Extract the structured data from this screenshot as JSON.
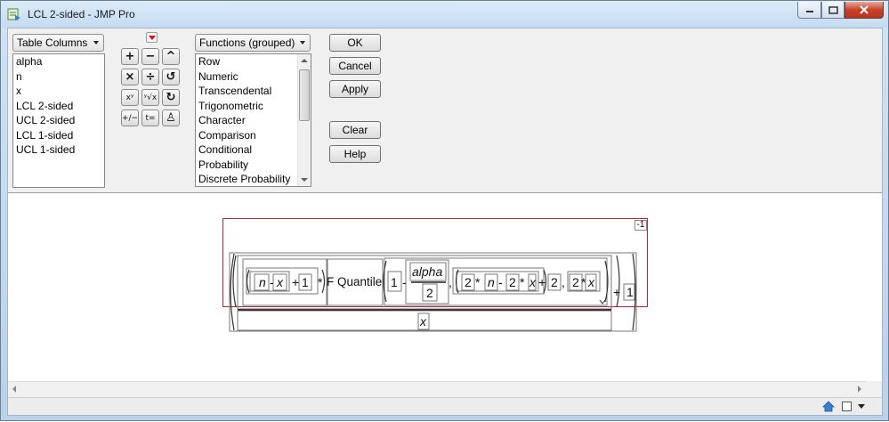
{
  "window": {
    "title": "LCL 2-sided - JMP Pro",
    "min": "minimize",
    "max": "maximize",
    "close": "close"
  },
  "columns": {
    "selector": "Table Columns",
    "items": [
      "alpha",
      "n",
      "x",
      "LCL 2-sided",
      "UCL 2-sided",
      "LCL 1-sided",
      "UCL 1-sided"
    ]
  },
  "functions": {
    "selector": "Functions (grouped)",
    "items": [
      "Row",
      "Numeric",
      "Transcendental",
      "Trigonometric",
      "Character",
      "Comparison",
      "Conditional",
      "Probability",
      "Discrete Probability"
    ]
  },
  "buttons": {
    "ok": "OK",
    "cancel": "Cancel",
    "apply": "Apply",
    "clear": "Clear",
    "help": "Help"
  },
  "keypad": [
    "+",
    "−",
    "^",
    "×",
    "÷",
    "↺",
    "xʸ",
    "ʸ√x",
    "↻",
    "+∕−",
    "t=",
    "♙"
  ],
  "formula": {
    "n": "n",
    "minus": "-",
    "x": "x",
    "plus": "+",
    "one": "1",
    "times": "*",
    "fquantile": "F Quantile",
    "alpha": "alpha",
    "two": "2",
    "comma": ",",
    "denominator": "x",
    "exponent": "-1"
  },
  "colors": {
    "formula_border": "#c8202e",
    "red_triangle": "#e01010"
  }
}
